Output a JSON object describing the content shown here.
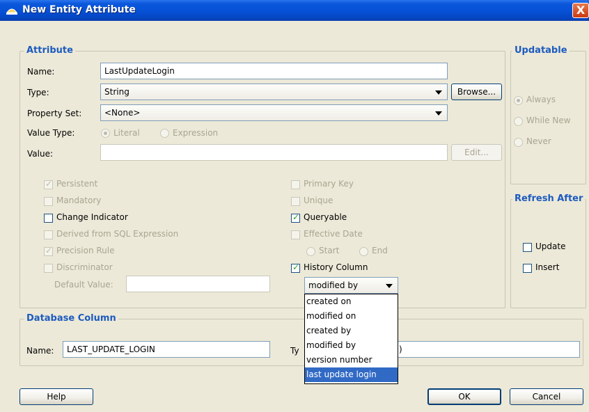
{
  "window": {
    "title": "New Entity Attribute",
    "close_label": "X"
  },
  "attribute_group": {
    "legend": "Attribute",
    "name_label": "Name:",
    "name_value": "LastUpdateLogin",
    "type_label": "Type:",
    "type_value": "String",
    "browse_label": "Browse...",
    "property_set_label": "Property Set:",
    "property_set_value": "<None>",
    "value_type_label": "Value Type:",
    "value_type_options": [
      "Literal",
      "Expression"
    ],
    "value_label": "Value:",
    "value_value": "",
    "edit_label": "Edit...",
    "checkboxes_left": [
      {
        "label": "Persistent",
        "checked": true,
        "enabled": false
      },
      {
        "label": "Mandatory",
        "checked": false,
        "enabled": false
      },
      {
        "label": "Change Indicator",
        "checked": false,
        "enabled": true
      },
      {
        "label": "Derived from SQL Expression",
        "checked": false,
        "enabled": false
      },
      {
        "label": "Precision Rule",
        "checked": true,
        "enabled": false
      },
      {
        "label": "Discriminator",
        "checked": false,
        "enabled": false
      }
    ],
    "default_value_label": "Default Value:",
    "checkboxes_right": [
      {
        "label": "Primary Key",
        "checked": false,
        "enabled": false
      },
      {
        "label": "Unique",
        "checked": false,
        "enabled": false
      },
      {
        "label": "Queryable",
        "checked": true,
        "enabled": true
      },
      {
        "label": "Effective Date",
        "checked": false,
        "enabled": false
      }
    ],
    "effective_date_options": [
      "Start",
      "End"
    ],
    "history_column_label": "History Column",
    "history_column_checked": true,
    "history_column_value": "modified by",
    "history_column_options": [
      "created on",
      "modified on",
      "created by",
      "modified by",
      "version number",
      "last update login"
    ],
    "history_column_highlighted": "last update login"
  },
  "updatable_group": {
    "legend": "Updatable",
    "options": [
      "Always",
      "While New",
      "Never"
    ],
    "selected": "Always"
  },
  "refresh_group": {
    "legend": "Refresh After",
    "options": [
      {
        "label": "Update",
        "checked": false
      },
      {
        "label": "Insert",
        "checked": false
      }
    ]
  },
  "database_group": {
    "legend": "Database Column",
    "name_label": "Name:",
    "name_value": "LAST_UPDATE_LOGIN",
    "type_label_visible": "Ty",
    "type_value_visible": ")"
  },
  "footer": {
    "help_label": "Help",
    "ok_label": "OK",
    "cancel_label": "Cancel"
  },
  "colors": {
    "titlebar": "#0650d6",
    "legend": "#1c5bbf",
    "selection": "#316ac5",
    "dialog_bg": "#ece9d8"
  },
  "icons": [
    "app-icon",
    "close-icon",
    "dropdown-arrow-icon",
    "check-icon"
  ]
}
